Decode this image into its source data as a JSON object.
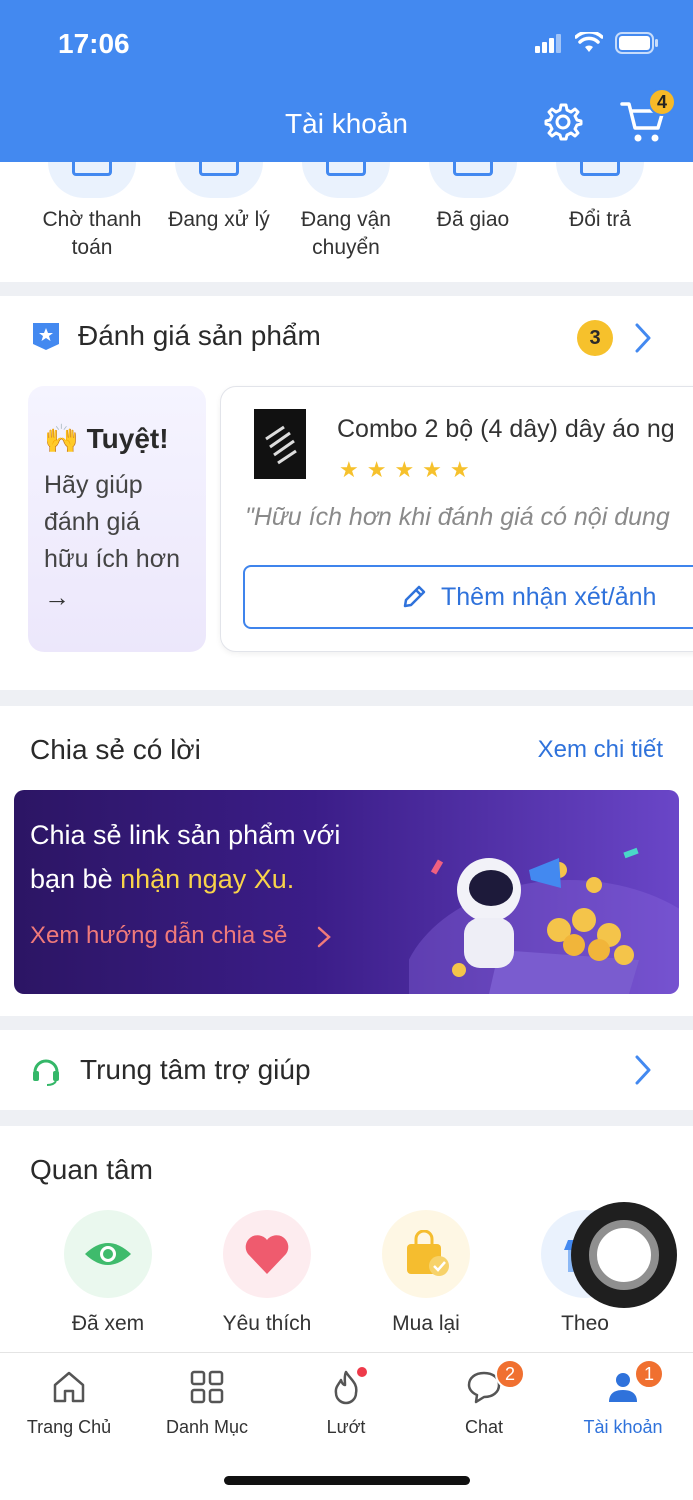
{
  "status_bar": {
    "time": "17:06"
  },
  "header": {
    "title": "Tài khoản",
    "cart_count": "4"
  },
  "orders": [
    {
      "label": "Chờ thanh toán"
    },
    {
      "label": "Đang xử lý"
    },
    {
      "label": "Đang vận chuyển"
    },
    {
      "label": "Đã giao"
    },
    {
      "label": "Đổi trả"
    }
  ],
  "review": {
    "title": "Đánh giá sản phẩm",
    "count": "3",
    "promo_title": "🙌 Tuyệt!",
    "promo_text": "Hãy giúp đánh giá hữu ích hơn",
    "promo_arrow": "→",
    "product_name": "Combo 2 bộ (4 dây) dây áo ng",
    "stars": "★★★★★",
    "hint": "\"Hữu ích hơn khi đánh giá có nội dung",
    "add_button": "Thêm nhận xét/ảnh"
  },
  "share": {
    "title": "Chia sẻ có lời",
    "link": "Xem chi tiết",
    "banner_line1": "Chia sẻ link sản phẩm với",
    "banner_line2_prefix": "bạn bè ",
    "banner_line2_highlight": "nhận ngay Xu.",
    "banner_cta": "Xem hướng dẫn chia sẻ"
  },
  "help": {
    "label": "Trung tâm trợ giúp"
  },
  "interest": {
    "title": "Quan tâm",
    "items": [
      {
        "label": "Đã xem"
      },
      {
        "label": "Yêu thích"
      },
      {
        "label": "Mua lại"
      },
      {
        "label": "Theo"
      }
    ]
  },
  "bottom_nav": {
    "items": [
      {
        "label": "Trang Chủ"
      },
      {
        "label": "Danh Mục"
      },
      {
        "label": "Lướt"
      },
      {
        "label": "Chat",
        "badge": "2"
      },
      {
        "label": "Tài khoản",
        "badge": "1"
      }
    ]
  },
  "colors": {
    "brand": "#4389f0",
    "link": "#2f72db",
    "badge": "#f6c12c",
    "notify": "#f07030"
  }
}
